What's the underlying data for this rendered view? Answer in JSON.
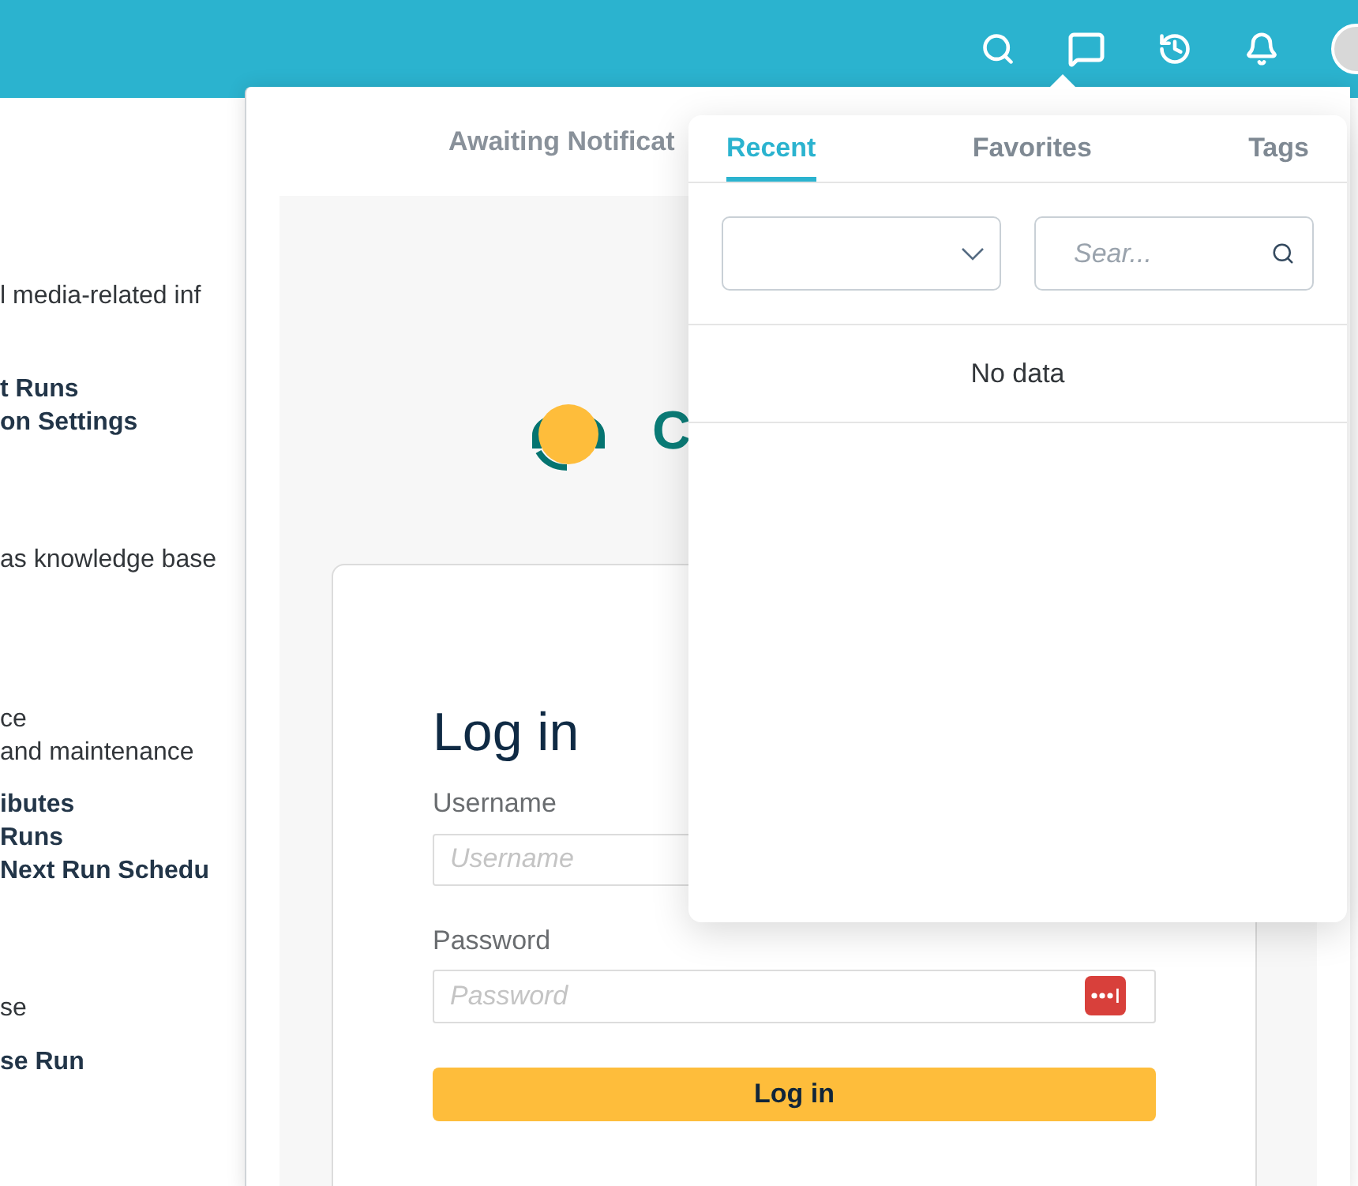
{
  "background_lines": [
    {
      "text": "l media-related inf",
      "kind": "normal"
    },
    {
      "text": "t Runs",
      "kind": "bold"
    },
    {
      "text": "on Settings",
      "kind": "bold"
    },
    {
      "text": "as knowledge base",
      "kind": "normal"
    },
    {
      "text": "ce",
      "kind": "normal"
    },
    {
      "text": "and maintenance",
      "kind": "normal"
    },
    {
      "text": "ibutes",
      "kind": "bold"
    },
    {
      "text": "Runs",
      "kind": "bold"
    },
    {
      "text": "Next Run Schedu",
      "kind": "bold"
    },
    {
      "text": "se",
      "kind": "normal"
    },
    {
      "text": "se Run",
      "kind": "bold"
    }
  ],
  "panel": {
    "title": "Awaiting Notificat",
    "logo_text": "C",
    "login": {
      "heading": "Log in",
      "username_label": "Username",
      "username_placeholder": "Username",
      "password_label": "Password",
      "password_placeholder": "Password",
      "button": "Log in"
    }
  },
  "popover": {
    "tabs": [
      {
        "label": "Recent",
        "selected": true
      },
      {
        "label": "Favorites",
        "selected": false
      },
      {
        "label": "Tags",
        "selected": false
      }
    ],
    "search_placeholder": "Sear...",
    "empty_text": "No data"
  }
}
